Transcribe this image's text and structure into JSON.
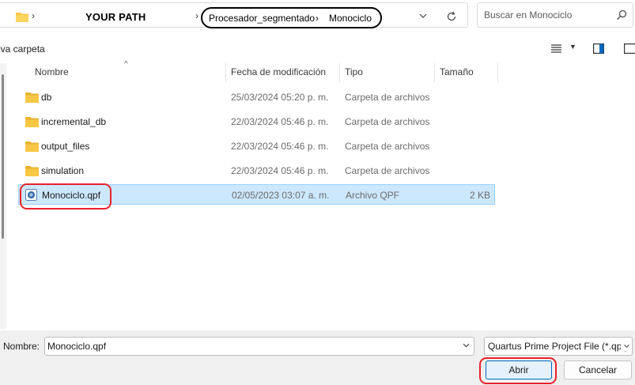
{
  "address_bar": {
    "path_label": "YOUR PATH",
    "crumbs": [
      "Procesador_segmentado",
      "Monociclo"
    ],
    "separator": "›",
    "dropdown_icon": "chevron-down-icon",
    "refresh_icon": "refresh-icon"
  },
  "search": {
    "placeholder": "Buscar en Monociclo",
    "icon": "search-icon"
  },
  "toolbar": {
    "new_folder_label": "eva carpeta"
  },
  "columns": {
    "name": "Nombre",
    "date": "Fecha de modificación",
    "type": "Tipo",
    "size": "Tamaño"
  },
  "files": [
    {
      "name": "db",
      "date": "25/03/2024 05:20 p. m.",
      "type": "Carpeta de archivos",
      "size": "",
      "icon": "folder-icon"
    },
    {
      "name": "incremental_db",
      "date": "22/03/2024 05:46 p. m.",
      "type": "Carpeta de archivos",
      "size": "",
      "icon": "folder-icon"
    },
    {
      "name": "output_files",
      "date": "22/03/2024 05:46 p. m.",
      "type": "Carpeta de archivos",
      "size": "",
      "icon": "folder-icon"
    },
    {
      "name": "simulation",
      "date": "22/03/2024 05:46 p. m.",
      "type": "Carpeta de archivos",
      "size": "",
      "icon": "folder-icon"
    },
    {
      "name": "Monociclo.qpf",
      "date": "02/05/2023 03:07 a. m.",
      "type": "Archivo QPF",
      "size": "2 KB",
      "icon": "quartus-project-icon",
      "selected": true
    }
  ],
  "footer": {
    "name_label": "Nombre:",
    "name_value": "Monociclo.qpf",
    "filetype_value": "Quartus Prime Project File (*.qpf)",
    "open_label": "Abrir",
    "cancel_label": "Cancelar"
  },
  "colors": {
    "selection_bg": "#cce8ff",
    "selection_border": "#99d1ff",
    "highlight_annotation": "#e8212b",
    "folder": "#f8c845",
    "accent": "#0067c0"
  }
}
